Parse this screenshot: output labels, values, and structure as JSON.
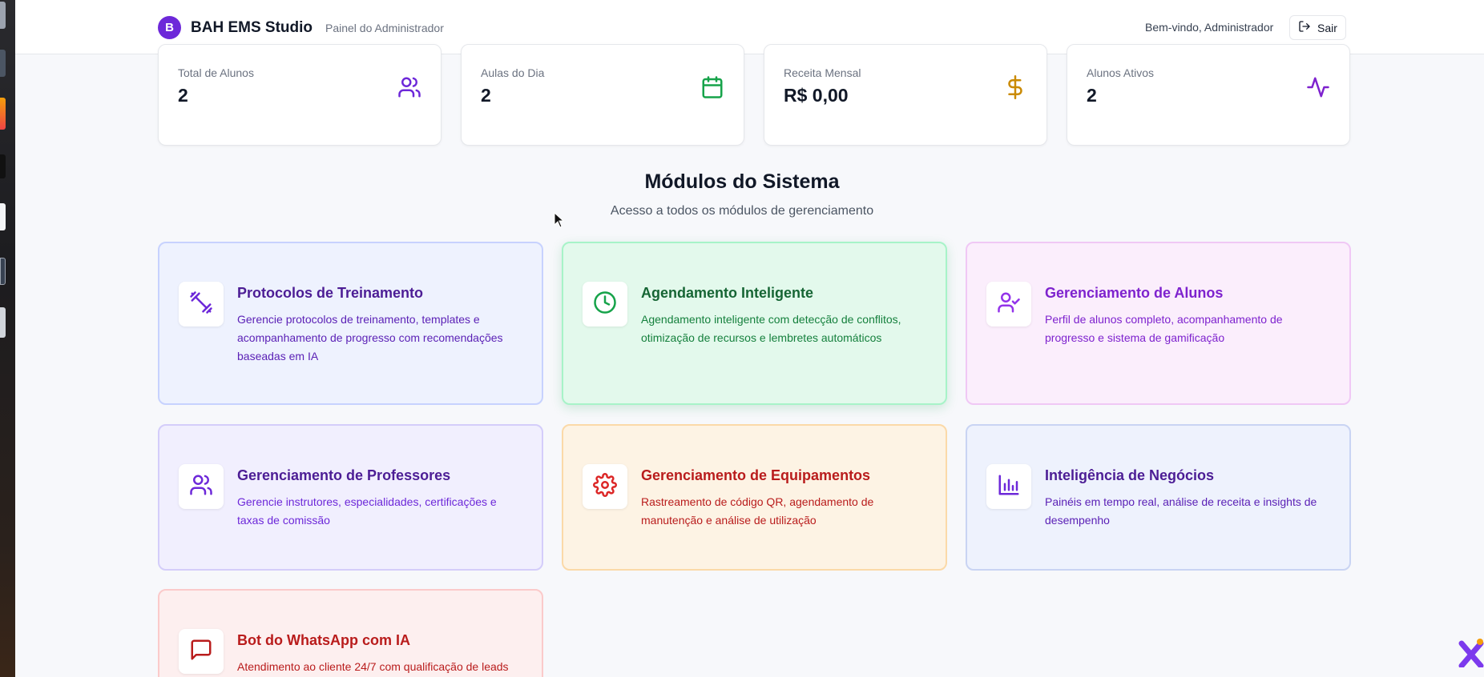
{
  "header": {
    "logo_letter": "B",
    "app_title": "BAH EMS Studio",
    "subtitle": "Painel do Administrador",
    "welcome": "Bem-vindo, Administrador",
    "logout_label": "Sair"
  },
  "stats": [
    {
      "label": "Total de Alunos",
      "value": "2",
      "icon": "users-icon",
      "color": "#6d28d9"
    },
    {
      "label": "Aulas do Dia",
      "value": "2",
      "icon": "calendar-icon",
      "color": "#16a34a"
    },
    {
      "label": "Receita Mensal",
      "value": "R$ 0,00",
      "icon": "dollar-icon",
      "color": "#ca8a04"
    },
    {
      "label": "Alunos Ativos",
      "value": "2",
      "icon": "activity-icon",
      "color": "#7e22ce"
    }
  ],
  "modules_section": {
    "title": "Módulos do Sistema",
    "subtitle": "Acesso a todos os módulos de gerenciamento"
  },
  "modules": [
    {
      "title": "Protocolos de Treinamento",
      "description": "Gerencie protocolos de treinamento, templates e acompanhamento de progresso com recomendações baseadas em IA",
      "icon": "dumbbell-icon",
      "title_color": "#4c1d95",
      "desc_color": "#5b21b6",
      "icon_color": "#6d28d9",
      "bg": "#eef2fe",
      "border": "#c7d2fe"
    },
    {
      "title": "Agendamento Inteligente",
      "description": "Agendamento inteligente com detecção de conflitos, otimização de recursos e lembretes automáticos",
      "icon": "clock-icon",
      "title_color": "#166534",
      "desc_color": "#15803d",
      "icon_color": "#16a34a",
      "bg": "#e3f9ec",
      "border": "#a7f3c8"
    },
    {
      "title": "Gerenciamento de Alunos",
      "description": "Perfil de alunos completo, acompanhamento de progresso e sistema de gamificação",
      "icon": "user-check-icon",
      "title_color": "#7e22ce",
      "desc_color": "#7e22ce",
      "icon_color": "#9333ea",
      "bg": "#fbeefc",
      "border": "#f0c8f5"
    },
    {
      "title": "Gerenciamento de Professores",
      "description": "Gerencie instrutores, especialidades, certificações e taxas de comissão",
      "icon": "users-icon",
      "title_color": "#4c1d95",
      "desc_color": "#6d28d9",
      "icon_color": "#6d28d9",
      "bg": "#f1effe",
      "border": "#d4cdfa"
    },
    {
      "title": "Gerenciamento de Equipamentos",
      "description": "Rastreamento de código QR, agendamento de manutenção e análise de utilização",
      "icon": "gear-icon",
      "title_color": "#b91c1c",
      "desc_color": "#b91c1c",
      "icon_color": "#dc2626",
      "bg": "#fdf3e4",
      "border": "#fbd9a8"
    },
    {
      "title": "Inteligência de Negócios",
      "description": "Painéis em tempo real, análise de receita e insights de desempenho",
      "icon": "bar-chart-icon",
      "title_color": "#4c1d95",
      "desc_color": "#5b21b6",
      "icon_color": "#6d28d9",
      "bg": "#eef2fd",
      "border": "#c9d4f3"
    },
    {
      "title": "Bot do WhatsApp com IA",
      "description": "Atendimento ao cliente 24/7 com qualificação de leads",
      "icon": "message-icon",
      "title_color": "#b91c1c",
      "desc_color": "#b91c1c",
      "icon_color": "#b91c1c",
      "bg": "#fdefef",
      "border": "#fbcaca"
    }
  ]
}
